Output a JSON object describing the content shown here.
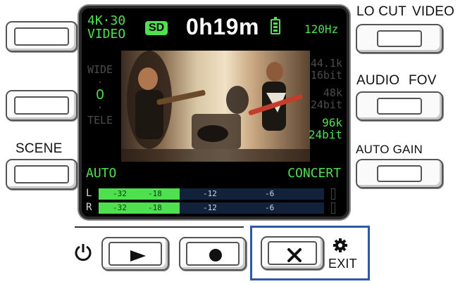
{
  "side_labels": {
    "lo_cut": "LO CUT",
    "video": "VIDEO",
    "audio": "AUDIO",
    "fov": "FOV",
    "scene": "SCENE",
    "auto_gain": "AUTO GAIN",
    "exit": "EXIT"
  },
  "screen": {
    "resolution": "4K·30",
    "mode": "VIDEO",
    "storage": "SD",
    "remaining_time": "0h19m",
    "framerate": "120Hz",
    "zoom_top": "WIDE",
    "zoom_value": "0",
    "zoom_bottom": "TELE",
    "rates": [
      {
        "rate": "44.1k",
        "bits": "16bit",
        "active": false
      },
      {
        "rate": "48k",
        "bits": "24bit",
        "active": false
      },
      {
        "rate": "96k",
        "bits": "24bit",
        "active": true
      }
    ],
    "scene": "AUTO",
    "scene_mode": "CONCERT",
    "meter": {
      "left_label": "L",
      "right_label": "R",
      "marks": [
        "-32",
        "-18",
        "-12",
        "-6"
      ],
      "left_level": 0.36,
      "right_level": 0.36
    }
  },
  "controls": {
    "power_icon": "power-icon",
    "play_icon": "play-icon",
    "record_icon": "record-icon",
    "exit_icon": "close-icon",
    "settings_icon": "gear-icon"
  },
  "colors": {
    "accent_green": "#4fe04f",
    "highlight_box": "#3058a8"
  }
}
